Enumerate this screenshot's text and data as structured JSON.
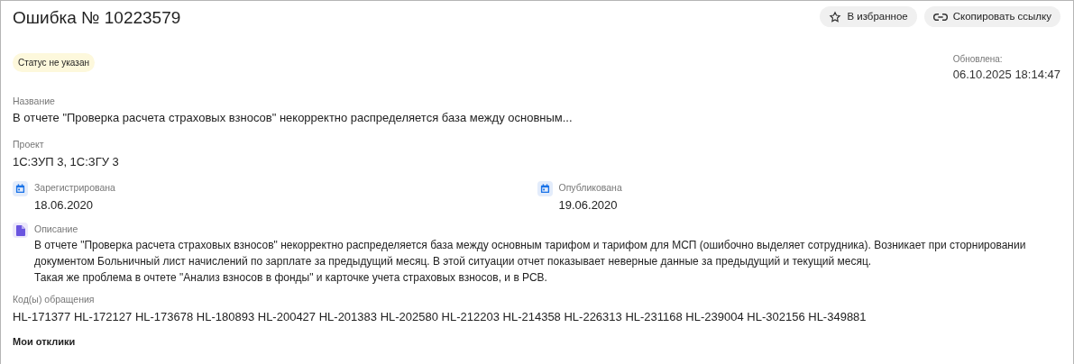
{
  "title": "Ошибка № 10223579",
  "actions": [
    {
      "kind": "star",
      "label": "В избранное"
    },
    {
      "kind": "link",
      "label": "Скопировать ссылку"
    }
  ],
  "status": "Статус не указан",
  "updated": {
    "label": "Обновлена:",
    "value": "06.10.2025 18:14:47"
  },
  "name": {
    "label": "Название",
    "value": "В отчете \"Проверка расчета страховых взносов\" некорректно распределяется база между основным..."
  },
  "project": {
    "label": "Проект",
    "value": "1С:ЗУП 3, 1С:ЗГУ 3"
  },
  "dates": [
    {
      "label": "Зарегистрирована",
      "value": "18.06.2020"
    },
    {
      "label": "Опубликована",
      "value": "19.06.2020"
    }
  ],
  "description": {
    "label": "Описание",
    "paragraphs": [
      "В отчете \"Проверка расчета страховых взносов\" некорректно распределяется база между основным тарифом и тарифом для МСП (ошибочно выделяет сотрудника). Возникает при сторнировании документом Больничный лист начислений по зарплате за предыдущий месяц. В этой ситуации отчет показывает неверные данные за предыдущий и текущий месяц.",
      "Такая же проблема в очтете \"Анализ взносов в фонды\" и карточке учета страховых взносов, и в РСВ."
    ]
  },
  "codes": {
    "label": "Код(ы) обращения",
    "value": "HL-171377 HL-172127 HL-173678 HL-180893 HL-200427 HL-201383 HL-202580 HL-212203 HL-214358 HL-226313 HL-231168 HL-239004 HL-302156 HL-349881"
  },
  "responses_heading": "Мои отклики"
}
